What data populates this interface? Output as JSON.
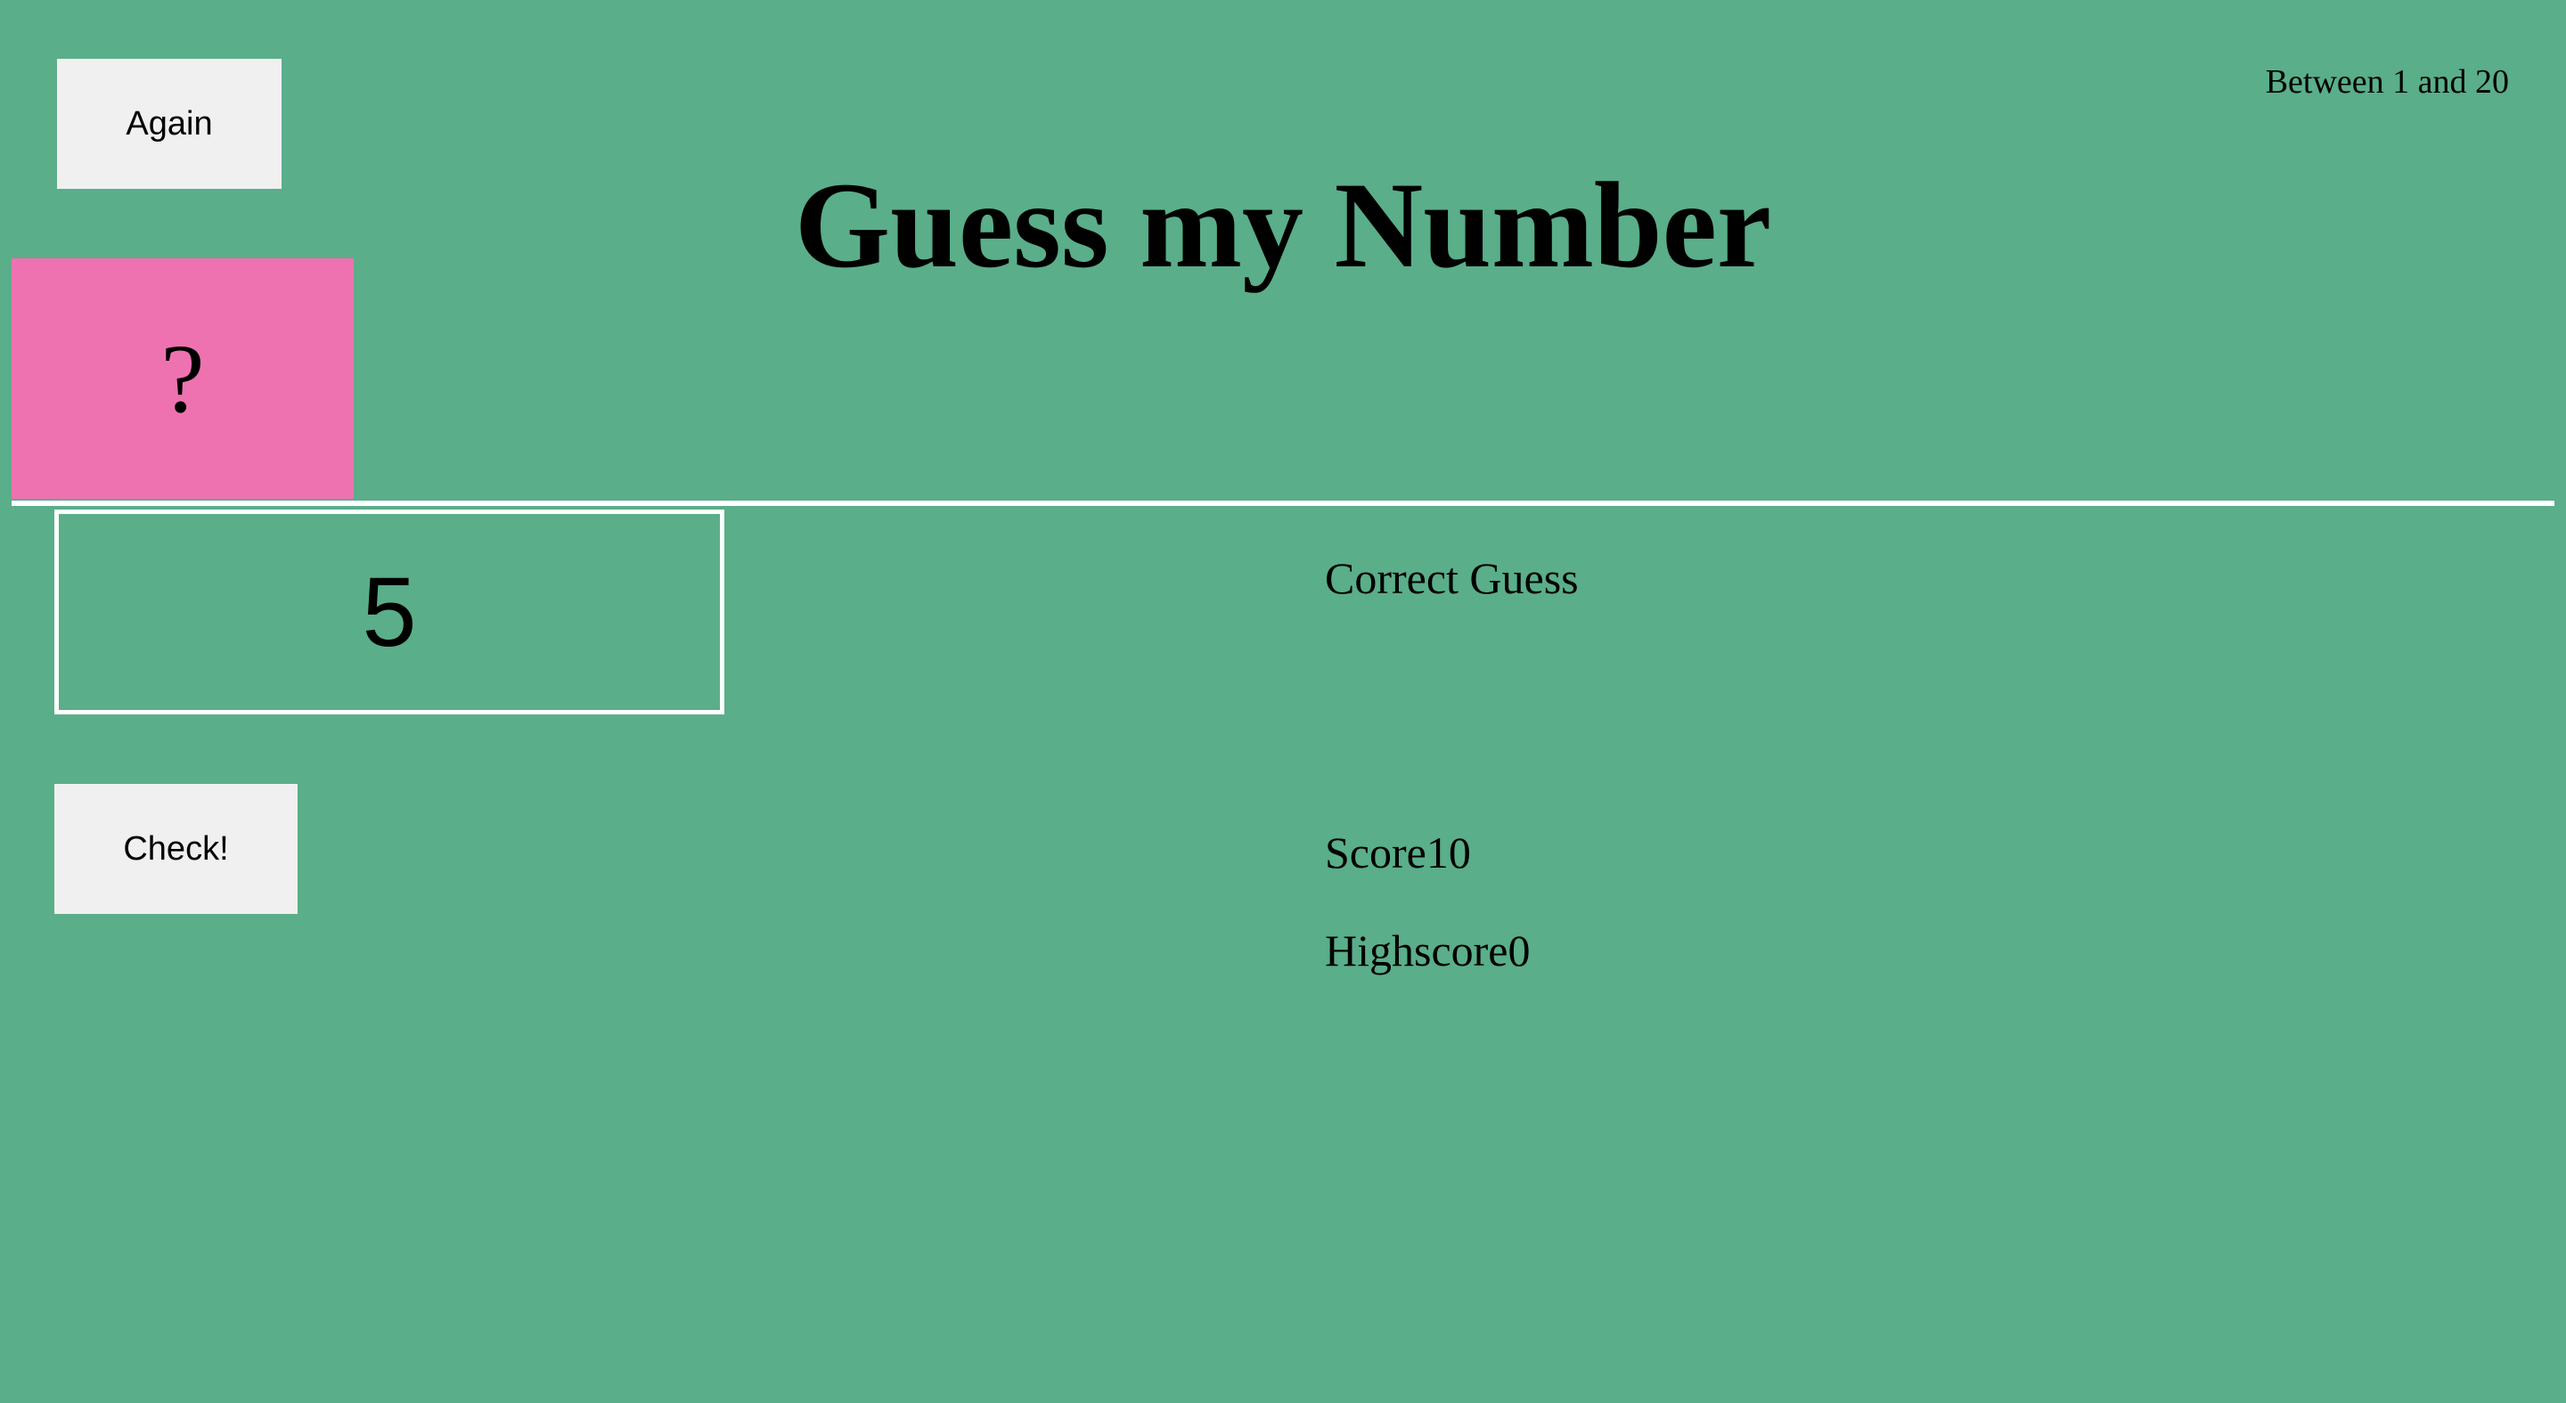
{
  "header": {
    "again_label": "Again",
    "range_hint": "Between 1 and 20",
    "title": "Guess my Number",
    "secret_display": "?"
  },
  "guess": {
    "value": "5"
  },
  "controls": {
    "check_label": "Check!"
  },
  "status": {
    "message": "Correct Guess",
    "score_label": "Score",
    "score_value": "10",
    "highscore_label": "Highscore",
    "highscore_value": "0"
  },
  "colors": {
    "background": "#5aae8a",
    "secret_box": "#ee72b0",
    "button": "#f0f0f0",
    "divider": "#ffffff"
  }
}
